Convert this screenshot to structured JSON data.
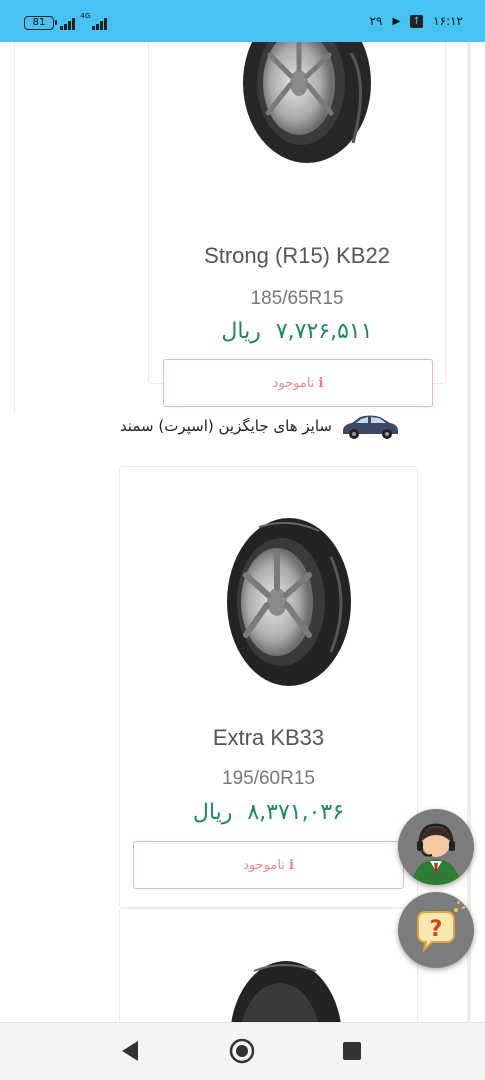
{
  "status_bar": {
    "battery": "81",
    "network": "4G",
    "date": "۲۹",
    "time": "۱۶:۱۲"
  },
  "products": [
    {
      "name": "Strong (R15) KB22",
      "size": "185/65R15",
      "price": "۷,۷۲۶,۵۱۱",
      "currency": "ریال",
      "stock_label": "ناموجود"
    },
    {
      "name": "Extra KB33",
      "size": "195/60R15",
      "price": "۸,۳۷۱,۰۳۶",
      "currency": "ریال",
      "stock_label": "ناموجود"
    }
  ],
  "section": {
    "title": "سایز های جایگزین (اسپرت) سمند",
    "icon": "car-icon"
  },
  "floating": {
    "support_icon": "support-agent-icon",
    "help_icon": "help-question-icon"
  },
  "nav": {
    "back_icon": "back-icon",
    "home_icon": "home-icon",
    "recents_icon": "recents-icon"
  },
  "colors": {
    "status_bar": "#48c2f1",
    "price": "#1a8a5a",
    "out_of_stock": "#f08a8a"
  }
}
